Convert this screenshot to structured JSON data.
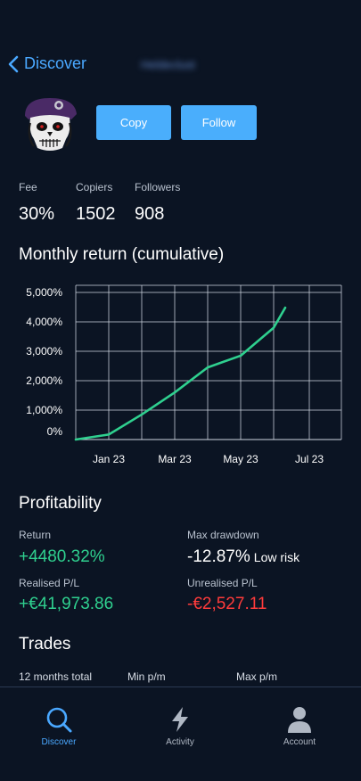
{
  "nav": {
    "back_label": "Discover",
    "username": "Heldeclust"
  },
  "actions": {
    "copy": "Copy",
    "follow": "Follow"
  },
  "stats": [
    {
      "label": "Fee",
      "value": "30%"
    },
    {
      "label": "Copiers",
      "value": "1502"
    },
    {
      "label": "Followers",
      "value": "908"
    }
  ],
  "chart_section": {
    "title": "Monthly return (cumulative)"
  },
  "chart_data": {
    "type": "line",
    "y_ticks": [
      "5,000%",
      "4,000%",
      "3,000%",
      "2,000%",
      "1,000%",
      "0%"
    ],
    "x_ticks": [
      "Jan 23",
      "Mar 23",
      "May 23",
      "Jul 23"
    ],
    "ylim": [
      0,
      5000
    ],
    "x": [
      "Dec 22",
      "Jan 23",
      "Feb 23",
      "Mar 23",
      "Apr 23",
      "May 23",
      "Jun 23",
      "Jun 23 (partial)"
    ],
    "series": [
      {
        "values": [
          0,
          170,
          850,
          1600,
          2450,
          2850,
          3800,
          4480
        ],
        "color": "#2fd08f"
      }
    ],
    "grid": true
  },
  "profitability": {
    "title": "Profitability",
    "return_label": "Return",
    "return_value": "+4480.32%",
    "max_drawdown_label": "Max drawdown",
    "max_drawdown_value": "-12.87%",
    "risk_label": "Low risk",
    "realised_label": "Realised P/L",
    "realised_value": "+€41,973.86",
    "unrealised_label": "Unrealised P/L",
    "unrealised_value": "-€2,527.11"
  },
  "trades": {
    "title": "Trades",
    "labels": [
      "12 months total",
      "Min p/m",
      "Max p/m"
    ]
  },
  "tabs": [
    {
      "label": "Discover",
      "icon": "search-icon",
      "active": true
    },
    {
      "label": "Activity",
      "icon": "lightning-icon",
      "active": false
    },
    {
      "label": "Account",
      "icon": "person-icon",
      "active": false
    }
  ],
  "colors": {
    "accent": "#4aa8ff",
    "positive": "#2fd08f",
    "negative": "#ff3b3b",
    "background": "#0b1423"
  }
}
